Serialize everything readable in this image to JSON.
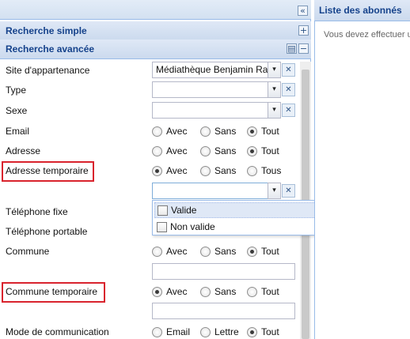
{
  "header": {
    "collapse_icon": "double-chevron-left",
    "right_title": "Liste des abonnés",
    "right_message": "Vous devez effectuer u"
  },
  "sections": {
    "simple": {
      "title": "Recherche simple",
      "icon": "plus"
    },
    "advanced": {
      "title": "Recherche avancée",
      "icons": [
        "save",
        "minus"
      ]
    }
  },
  "fields": {
    "site": {
      "label": "Site d'appartenance",
      "value": "Médiathèque Benjamin Ra"
    },
    "type": {
      "label": "Type",
      "value": ""
    },
    "sexe": {
      "label": "Sexe",
      "value": ""
    },
    "email": {
      "label": "Email",
      "options": [
        "Avec",
        "Sans",
        "Tout"
      ],
      "selected": "Tout"
    },
    "adresse": {
      "label": "Adresse",
      "options": [
        "Avec",
        "Sans",
        "Tout"
      ],
      "selected": "Tout"
    },
    "adresse_temp": {
      "label": "Adresse temporaire",
      "options": [
        "Avec",
        "Sans",
        "Tous"
      ],
      "selected": "Avec"
    },
    "tel_fixe": {
      "label": "Téléphone fixe"
    },
    "tel_portable": {
      "label": "Téléphone portable"
    },
    "commune": {
      "label": "Commune",
      "options": [
        "Avec",
        "Sans",
        "Tout"
      ],
      "selected": "Tout"
    },
    "commune_temp": {
      "label": "Commune temporaire",
      "options": [
        "Avec",
        "Sans",
        "Tout"
      ],
      "selected": "Avec"
    },
    "mode_comm": {
      "label": "Mode de communication",
      "options": [
        "Email",
        "Lettre",
        "Tout"
      ],
      "selected": "Tout"
    }
  },
  "dropdown": {
    "items": [
      {
        "label": "Valide",
        "checked": false
      },
      {
        "label": "Non valide",
        "checked": false
      }
    ]
  },
  "icons": {
    "arrow": "▾",
    "clear": "✕"
  },
  "colors": {
    "header_text": "#15428b",
    "highlight_border": "#d9232d",
    "panel_border": "#99bbe8"
  }
}
